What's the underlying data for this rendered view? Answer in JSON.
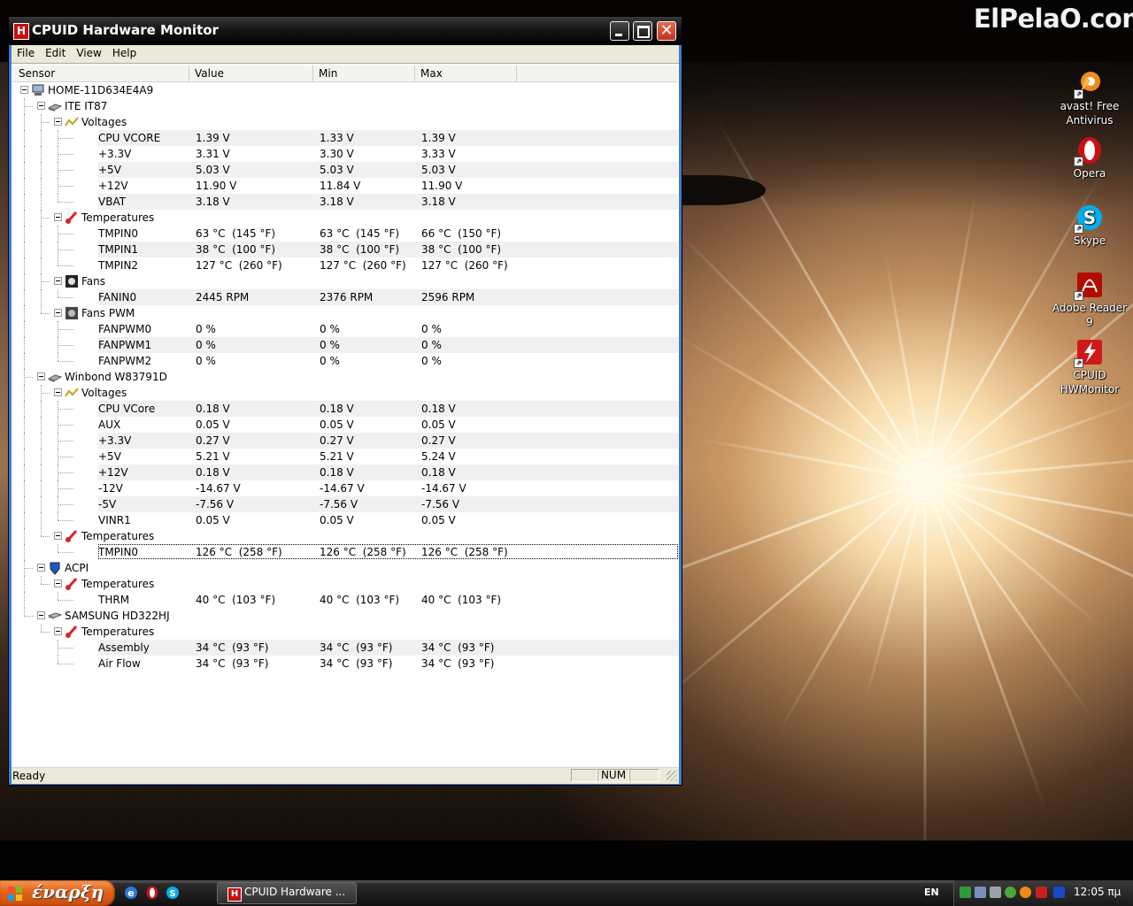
{
  "desktop": {
    "brand": "ElPelaO.com",
    "icons": [
      {
        "label": "avast! Free Antivirus",
        "icon": "avast-icon",
        "color": "#f08a1c"
      },
      {
        "label": "Opera",
        "icon": "opera-icon",
        "color": "#cc0f16"
      },
      {
        "label": "Skype",
        "icon": "skype-icon",
        "color": "#00aff0"
      },
      {
        "label": "Adobe Reader 9",
        "icon": "adobe-reader-icon",
        "color": "#b30b00"
      },
      {
        "label": "CPUID HWMonitor",
        "icon": "cpuid-hwmonitor-icon",
        "color": "#d01818"
      }
    ]
  },
  "window": {
    "title": "CPUID Hardware Monitor",
    "app_icon_letter": "H",
    "close_glyph": "✕",
    "menu": [
      "File",
      "Edit",
      "View",
      "Help"
    ],
    "columns": [
      "Sensor",
      "Value",
      "Min",
      "Max"
    ],
    "rows": [
      {
        "level": 0,
        "kind": "computer",
        "label": "HOME-11D634E4A9"
      },
      {
        "level": 1,
        "kind": "chip",
        "label": "ITE IT87"
      },
      {
        "level": 2,
        "kind": "voltage",
        "label": "Voltages"
      },
      {
        "level": 3,
        "kind": "leaf",
        "label": "CPU VCORE",
        "value": "1.39 V",
        "min": "1.33 V",
        "max": "1.39 V"
      },
      {
        "level": 3,
        "kind": "leaf",
        "label": "+3.3V",
        "value": "3.31 V",
        "min": "3.30 V",
        "max": "3.33 V"
      },
      {
        "level": 3,
        "kind": "leaf",
        "label": "+5V",
        "value": "5.03 V",
        "min": "5.03 V",
        "max": "5.03 V"
      },
      {
        "level": 3,
        "kind": "leaf",
        "label": "+12V",
        "value": "11.90 V",
        "min": "11.84 V",
        "max": "11.90 V"
      },
      {
        "level": 3,
        "kind": "leaf",
        "label": "VBAT",
        "value": "3.18 V",
        "min": "3.18 V",
        "max": "3.18 V"
      },
      {
        "level": 2,
        "kind": "temp",
        "label": "Temperatures"
      },
      {
        "level": 3,
        "kind": "leaf",
        "label": "TMPIN0",
        "value": "63 °C  (145 °F)",
        "min": "63 °C  (145 °F)",
        "max": "66 °C  (150 °F)"
      },
      {
        "level": 3,
        "kind": "leaf",
        "label": "TMPIN1",
        "value": "38 °C  (100 °F)",
        "min": "38 °C  (100 °F)",
        "max": "38 °C  (100 °F)"
      },
      {
        "level": 3,
        "kind": "leaf",
        "label": "TMPIN2",
        "value": "127 °C  (260 °F)",
        "min": "127 °C  (260 °F)",
        "max": "127 °C  (260 °F)"
      },
      {
        "level": 2,
        "kind": "fan",
        "label": "Fans"
      },
      {
        "level": 3,
        "kind": "leaf",
        "label": "FANIN0",
        "value": "2445 RPM",
        "min": "2376 RPM",
        "max": "2596 RPM"
      },
      {
        "level": 2,
        "kind": "fanpwm",
        "label": "Fans PWM"
      },
      {
        "level": 3,
        "kind": "leaf",
        "label": "FANPWM0",
        "value": "0 %",
        "min": "0 %",
        "max": "0 %"
      },
      {
        "level": 3,
        "kind": "leaf",
        "label": "FANPWM1",
        "value": "0 %",
        "min": "0 %",
        "max": "0 %"
      },
      {
        "level": 3,
        "kind": "leaf",
        "label": "FANPWM2",
        "value": "0 %",
        "min": "0 %",
        "max": "0 %"
      },
      {
        "level": 1,
        "kind": "chip",
        "label": "Winbond W83791D"
      },
      {
        "level": 2,
        "kind": "voltage",
        "label": "Voltages"
      },
      {
        "level": 3,
        "kind": "leaf",
        "label": "CPU VCore",
        "value": "0.18 V",
        "min": "0.18 V",
        "max": "0.18 V"
      },
      {
        "level": 3,
        "kind": "leaf",
        "label": "AUX",
        "value": "0.05 V",
        "min": "0.05 V",
        "max": "0.05 V"
      },
      {
        "level": 3,
        "kind": "leaf",
        "label": "+3.3V",
        "value": "0.27 V",
        "min": "0.27 V",
        "max": "0.27 V"
      },
      {
        "level": 3,
        "kind": "leaf",
        "label": "+5V",
        "value": "5.21 V",
        "min": "5.21 V",
        "max": "5.24 V"
      },
      {
        "level": 3,
        "kind": "leaf",
        "label": "+12V",
        "value": "0.18 V",
        "min": "0.18 V",
        "max": "0.18 V"
      },
      {
        "level": 3,
        "kind": "leaf",
        "label": "-12V",
        "value": "-14.67 V",
        "min": "-14.67 V",
        "max": "-14.67 V"
      },
      {
        "level": 3,
        "kind": "leaf",
        "label": "-5V",
        "value": "-7.56 V",
        "min": "-7.56 V",
        "max": "-7.56 V"
      },
      {
        "level": 3,
        "kind": "leaf",
        "label": "VINR1",
        "value": "0.05 V",
        "min": "0.05 V",
        "max": "0.05 V"
      },
      {
        "level": 2,
        "kind": "temp",
        "label": "Temperatures"
      },
      {
        "level": 3,
        "kind": "leaf",
        "label": "TMPIN0",
        "value": "126 °C  (258 °F)",
        "min": "126 °C  (258 °F)",
        "max": "126 °C  (258 °F)",
        "selected": true
      },
      {
        "level": 1,
        "kind": "acpi",
        "label": "ACPI"
      },
      {
        "level": 2,
        "kind": "temp",
        "label": "Temperatures"
      },
      {
        "level": 3,
        "kind": "leaf",
        "label": "THRM",
        "value": "40 °C  (103 °F)",
        "min": "40 °C  (103 °F)",
        "max": "40 °C  (103 °F)"
      },
      {
        "level": 1,
        "kind": "disk",
        "label": "SAMSUNG HD322HJ"
      },
      {
        "level": 2,
        "kind": "temp",
        "label": "Temperatures"
      },
      {
        "level": 3,
        "kind": "leaf",
        "label": "Assembly",
        "value": "34 °C  (93 °F)",
        "min": "34 °C  (93 °F)",
        "max": "34 °C  (93 °F)"
      },
      {
        "level": 3,
        "kind": "leaf",
        "label": "Air Flow",
        "value": "34 °C  (93 °F)",
        "min": "34 °C  (93 °F)",
        "max": "34 °C  (93 °F)",
        "last": true
      }
    ],
    "status": {
      "text": "Ready",
      "num": "NUM"
    }
  },
  "taskbar": {
    "start_label": "έναρξη",
    "task_label": "CPUID Hardware ...",
    "task_icon_letter": "H",
    "language": "EN",
    "clock": "12:05 πμ",
    "colors": {
      "start": "#e8661c",
      "selection_border": "#000000"
    }
  }
}
